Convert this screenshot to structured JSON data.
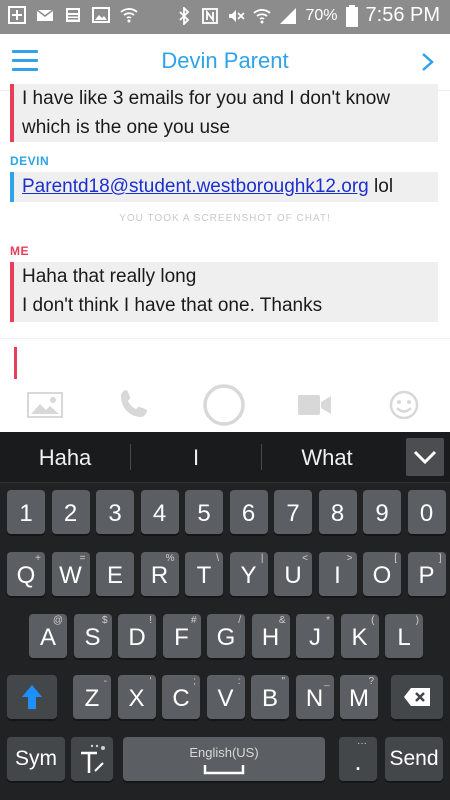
{
  "status_bar": {
    "battery": "70%",
    "time": "7:56 PM"
  },
  "header": {
    "title": "Devin Parent"
  },
  "chat": {
    "msg1": {
      "lines": [
        "I have like 3 emails for you and I don't know",
        "which is the one you use"
      ]
    },
    "msg2_sender": "DEVIN",
    "msg2": {
      "link": "Parentd18@student.westboroughk12.org",
      "suffix": " lol"
    },
    "notice": "YOU TOOK A SCREENSHOT OF CHAT!",
    "msg3_sender": "ME",
    "msg3": {
      "lines": [
        "Haha that really long",
        "I don't think I have that one. Thanks"
      ]
    }
  },
  "actions": {
    "icons": [
      "image-icon",
      "phone-icon",
      "capture-button",
      "video-icon",
      "emoji-icon"
    ]
  },
  "keyboard": {
    "suggestions": [
      "Haha",
      "I",
      "What"
    ],
    "number_row": [
      "1",
      "2",
      "3",
      "4",
      "5",
      "6",
      "7",
      "8",
      "9",
      "0"
    ],
    "row1": [
      {
        "k": "Q",
        "s": "+"
      },
      {
        "k": "W",
        "s": "="
      },
      {
        "k": "E",
        "s": ""
      },
      {
        "k": "R",
        "s": "%"
      },
      {
        "k": "T",
        "s": "\\"
      },
      {
        "k": "Y",
        "s": "|"
      },
      {
        "k": "U",
        "s": "<"
      },
      {
        "k": "I",
        "s": ">"
      },
      {
        "k": "O",
        "s": "["
      },
      {
        "k": "P",
        "s": "]"
      }
    ],
    "row2": [
      {
        "k": "A",
        "s": "@"
      },
      {
        "k": "S",
        "s": "$"
      },
      {
        "k": "D",
        "s": "!"
      },
      {
        "k": "F",
        "s": "#"
      },
      {
        "k": "G",
        "s": "/"
      },
      {
        "k": "H",
        "s": "&"
      },
      {
        "k": "J",
        "s": "*"
      },
      {
        "k": "K",
        "s": "("
      },
      {
        "k": "L",
        "s": ")"
      }
    ],
    "row3": [
      {
        "k": "Z",
        "s": "-"
      },
      {
        "k": "X",
        "s": "'"
      },
      {
        "k": "C",
        "s": ";"
      },
      {
        "k": "V",
        "s": ":"
      },
      {
        "k": "B",
        "s": "\""
      },
      {
        "k": "N",
        "s": "_"
      },
      {
        "k": "M",
        "s": "?"
      }
    ],
    "sym_label": "Sym",
    "space_label": "English(US)",
    "period_label": ".",
    "send_label": "Send"
  },
  "colors": {
    "accent_blue": "#2fa3ea",
    "accent_red": "#e83e5a",
    "link": "#1c2fcf"
  }
}
